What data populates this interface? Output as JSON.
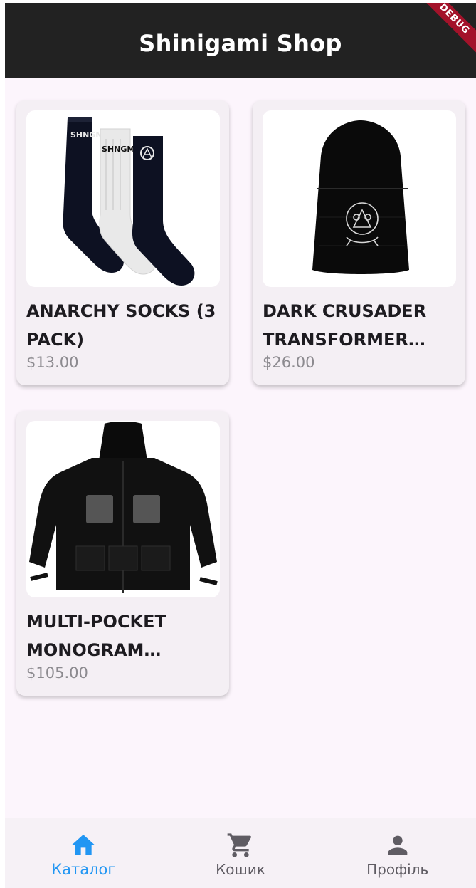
{
  "app_bar": {
    "title": "Shinigami Shop",
    "debug_banner": "DEBUG"
  },
  "products": [
    {
      "name": "ANARCHY SOCKS (3 PACK)",
      "price": "$13.00",
      "image": "socks-image"
    },
    {
      "name": "DARK CRUSADER TRANSFORMER BEANIE",
      "price": "$26.00",
      "image": "beanie-image"
    },
    {
      "name": "MULTI-POCKET MONOGRAM WINDBREAKER",
      "price": "$105.00",
      "image": "jacket-image"
    }
  ],
  "bottom_nav": {
    "items": [
      {
        "label": "Каталог",
        "icon": "home-icon",
        "active": true
      },
      {
        "label": "Кошик",
        "icon": "cart-icon",
        "active": false
      },
      {
        "label": "Профіль",
        "icon": "person-icon",
        "active": false
      }
    ]
  },
  "colors": {
    "app_bar": "#222222",
    "background": "#fcf5fc",
    "card": "#f4eff4",
    "active_nav": "#2196f3",
    "price": "#8c8a8f"
  }
}
